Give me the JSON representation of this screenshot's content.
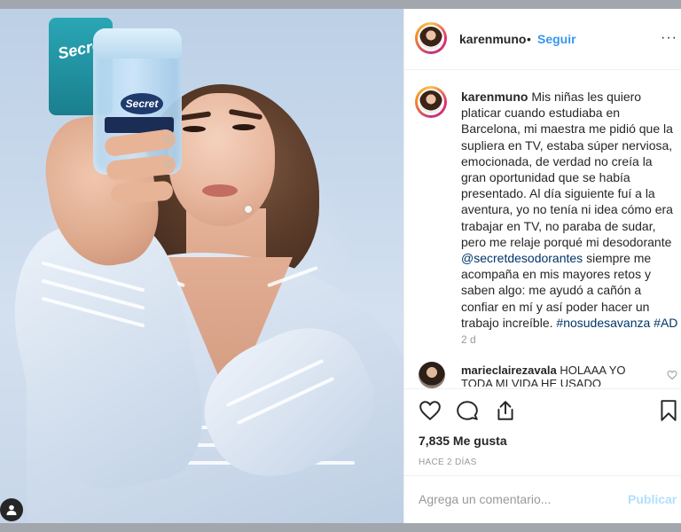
{
  "post": {
    "username": "karenmuno",
    "separator": "•",
    "follow_label": "Seguir",
    "more_label": "···"
  },
  "caption": {
    "username": "karenmuno",
    "text_before_mention": "Mis niñas les quiero platicar cuando estudiaba en Barcelona, mi maestra me pidió que la supliera en TV, estaba súper nerviosa, emocionada, de verdad no creía la gran oportunidad que se había presentado. Al día siguiente fuí a la aventura, yo no tenía ni idea cómo era trabajar en TV, no paraba de sudar, pero me relaje porqué mi desodorante",
    "mention": "@secretdesodorantes",
    "text_after_mention": "siempre me acompaña en mis mayores retos y saben algo: me ayudó a cañón a confiar en mí y así poder hacer un trabajo increíble.",
    "hashtag_1": "#nosudesavanza",
    "hashtag_2": "#AD",
    "time_ago": "2 d"
  },
  "comment": {
    "username": "marieclairezavala",
    "text": "HOLAAA YO TODA MI VIDA HE USADO"
  },
  "photo": {
    "brand_back": "Secret",
    "brand_front": "Secret"
  },
  "stats": {
    "likes": "7,835 Me gusta",
    "date": "HACE 2 DÍAS"
  },
  "comment_box": {
    "placeholder": "Agrega un comentario...",
    "publish_label": "Publicar"
  },
  "colors": {
    "link": "#003569",
    "follow": "#3897f0",
    "publish_disabled": "#b2dffc"
  }
}
